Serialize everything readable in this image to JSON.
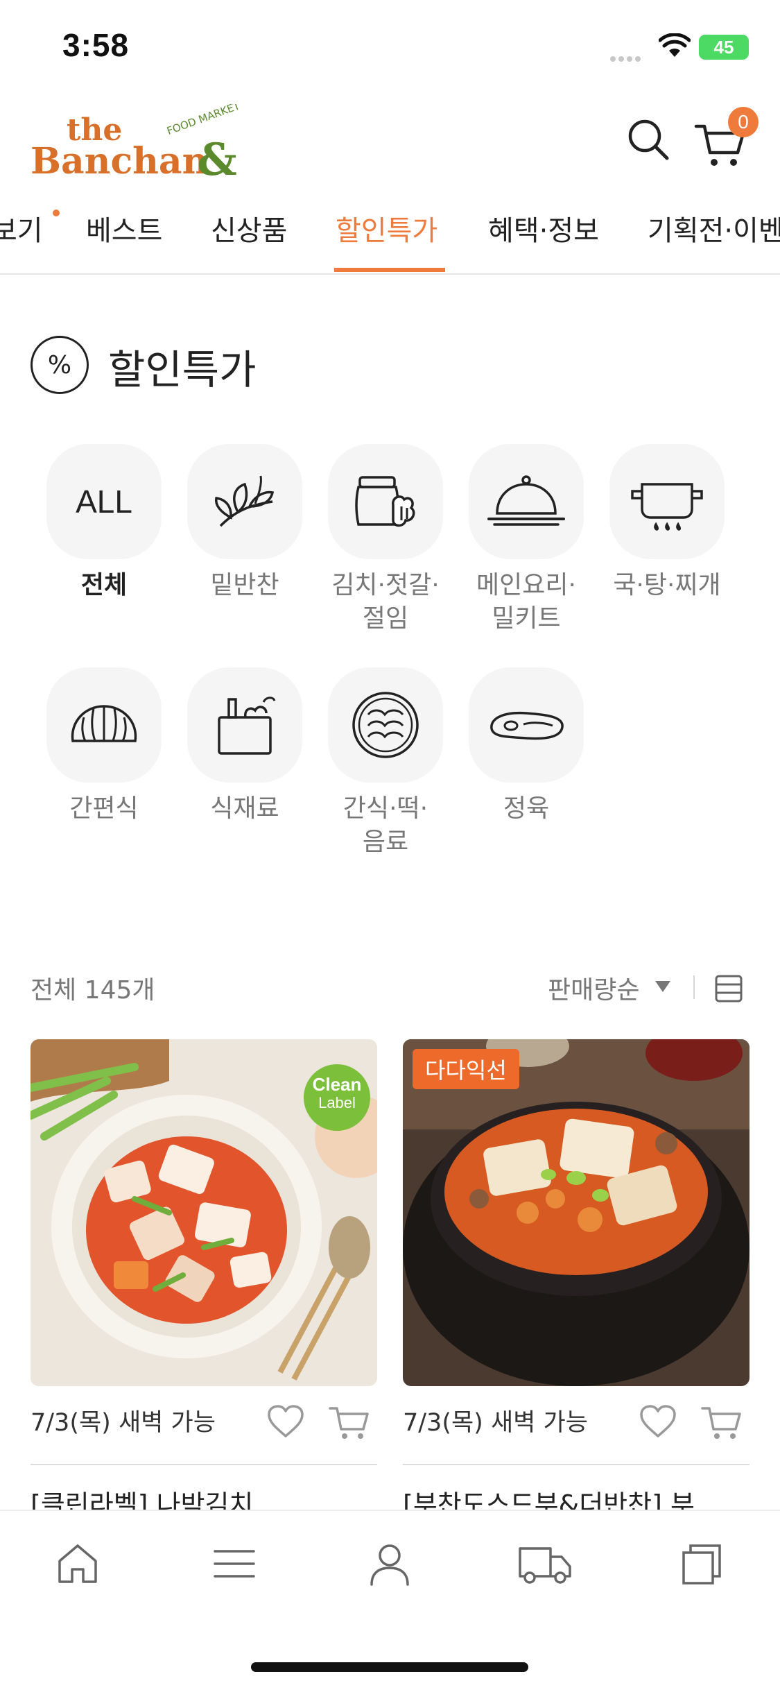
{
  "status": {
    "time": "3:58",
    "battery": "45"
  },
  "header": {
    "logo_the": "the",
    "logo_banchan": "Banchan&",
    "logo_market": "FOOD MARKET",
    "cart_count": "0"
  },
  "nav": {
    "tabs": [
      {
        "label": "보기"
      },
      {
        "label": "베스트"
      },
      {
        "label": "신상품"
      },
      {
        "label": "할인특가"
      },
      {
        "label": "혜택·정보"
      },
      {
        "label": "기획전·이벤"
      }
    ]
  },
  "section": {
    "badge": "%",
    "title": "할인특가"
  },
  "categories": [
    {
      "label": "전체",
      "icon": "all-icon",
      "icon_text": "ALL"
    },
    {
      "label": "밑반찬",
      "icon": "leaf-icon"
    },
    {
      "label_1": "김치·젓갈·",
      "label_2": "절임",
      "icon": "kimchi-jar-icon"
    },
    {
      "label_1": "메인요리·",
      "label_2": "밀키트",
      "icon": "cloche-icon"
    },
    {
      "label": "국·탕·찌개",
      "icon": "pot-icon"
    },
    {
      "label": "간편식",
      "icon": "dumpling-icon"
    },
    {
      "label": "식재료",
      "icon": "grocery-bag-icon"
    },
    {
      "label_1": "간식·떡·",
      "label_2": "음료",
      "icon": "rice-cake-icon"
    },
    {
      "label": "정육",
      "icon": "steak-icon"
    }
  ],
  "list": {
    "count": "전체 145개",
    "sort": "판매량순"
  },
  "products": [
    {
      "delivery": "7/3(목) 새벽 가능",
      "title": "[클린라벨] 나박김치",
      "badge_1": "Clean",
      "badge_2": "Label"
    },
    {
      "delivery": "7/3(목) 새벽 가능",
      "title": "[부찬도스드부&더반찬] 부",
      "tag": "다다익선"
    }
  ],
  "colors": {
    "accent": "#ee7a3c",
    "brand_green": "#5a8a2c",
    "clean_label": "#7bbf3a"
  }
}
